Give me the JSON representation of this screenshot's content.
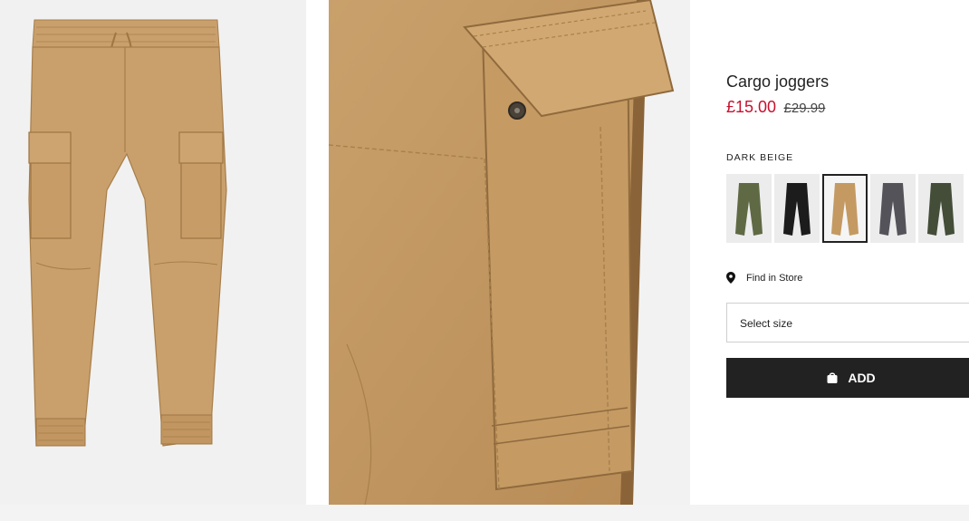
{
  "product": {
    "title": "Cargo joggers",
    "sale_price": "£15.00",
    "original_price": "£29.99",
    "selected_color": "DARK BEIGE",
    "colors": [
      "khaki green",
      "black",
      "dark beige",
      "dark grey",
      "dark green"
    ],
    "selected_index": 2
  },
  "store": {
    "label": "Find in Store"
  },
  "size": {
    "placeholder": "Select size"
  },
  "cart": {
    "add_label": "ADD"
  },
  "colors": {
    "sale": "#c8102e",
    "button": "#222222",
    "beige": "#c49a62"
  }
}
